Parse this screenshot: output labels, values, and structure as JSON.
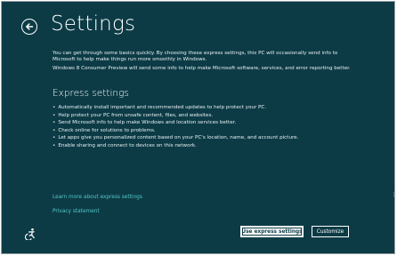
{
  "header": {
    "title": "Settings"
  },
  "intro": {
    "paragraph1": "You can get through some basics quickly. By choosing these express settings, this PC will occasionally send info to Microsoft to help make things run more smoothly in Windows.",
    "paragraph2": "Windows 8 Consumer Preview will send some info to help make Microsoft software, services, and error reporting better."
  },
  "express": {
    "title": "Express settings",
    "items": [
      "Automatically install important and recommended updates to help protect your PC.",
      "Help protect your PC from unsafe content, files, and websites.",
      "Send Microsoft info to help make Windows and location services better.",
      "Check online for solutions to problems.",
      "Let apps give you personalized content based on your PC's location, name, and account picture.",
      "Enable sharing and connect to devices on this network."
    ]
  },
  "links": {
    "learn_more": "Learn more about express settings",
    "privacy": "Privacy statement"
  },
  "buttons": {
    "use_express": "Use express settings",
    "customize": "Customize"
  },
  "colors": {
    "background": "#0c3b46",
    "link": "#55c8c8",
    "text": "#ffffff"
  },
  "icons": [
    "back-arrow-icon",
    "ease-of-access-icon",
    "mouse-cursor-icon"
  ]
}
